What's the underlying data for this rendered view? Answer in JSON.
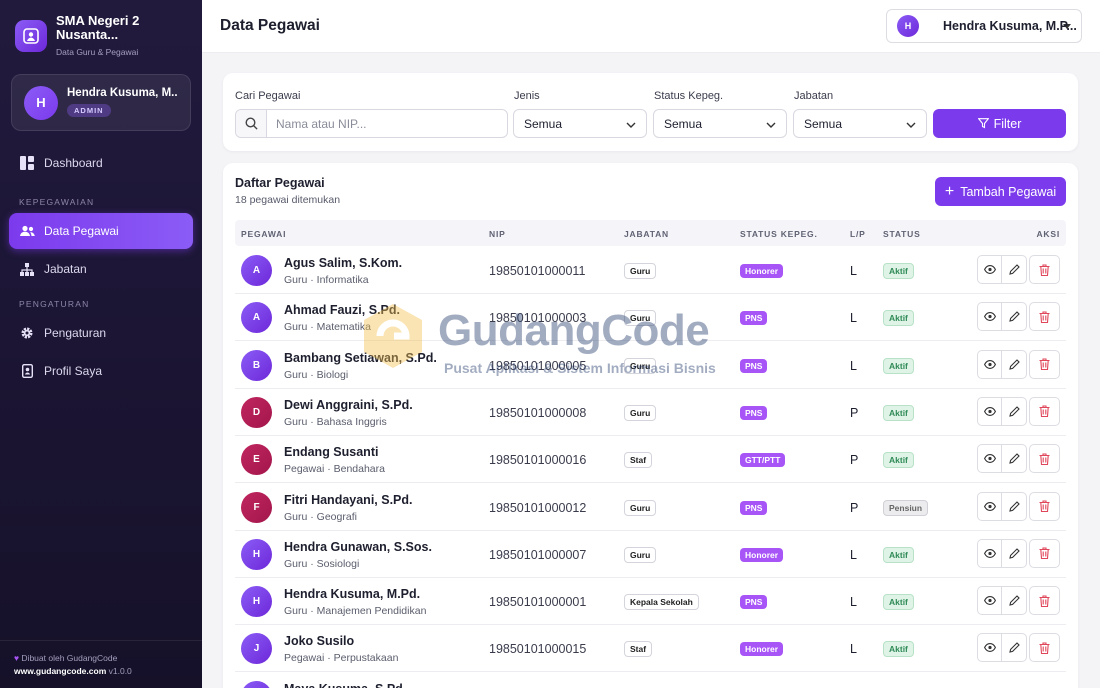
{
  "app": {
    "name": "SMA Negeri 2 Nusanta...",
    "subtitle": "Data Guru & Pegawai"
  },
  "sidebar": {
    "user": {
      "initial": "H",
      "name": "Hendra Kusuma, M...",
      "role": "ADMIN"
    },
    "items": [
      {
        "label": "Dashboard",
        "icon": "dashboard-icon"
      },
      {
        "section": "KEPEGAWAIAN"
      },
      {
        "label": "Data Pegawai",
        "icon": "users-icon",
        "active": true
      },
      {
        "label": "Jabatan",
        "icon": "org-chart-icon"
      },
      {
        "section": "PENGATURAN"
      },
      {
        "label": "Pengaturan",
        "icon": "gear-icon"
      },
      {
        "label": "Profil Saya",
        "icon": "id-badge-icon"
      }
    ],
    "footer": {
      "made_by": "Dibuat oleh GudangCode",
      "site": "www.gudangcode.com",
      "version": "v1.0.0"
    }
  },
  "topbar": {
    "title": "Data Pegawai",
    "user_initial": "H",
    "user_name": "Hendra Kusuma, M.P..."
  },
  "filters": {
    "search_label": "Cari Pegawai",
    "search_placeholder": "Nama atau NIP...",
    "jenis_label": "Jenis",
    "jenis_value": "Semua",
    "status_label": "Status Kepeg.",
    "status_value": "Semua",
    "jabatan_label": "Jabatan",
    "jabatan_value": "Semua",
    "button": "Filter"
  },
  "table": {
    "title": "Daftar Pegawai",
    "count_text": "18 pegawai ditemukan",
    "add_button": "Tambah Pegawai",
    "columns": [
      "PEGAWAI",
      "NIP",
      "JABATAN",
      "STATUS KEPEG.",
      "L/P",
      "STATUS",
      "AKSI"
    ],
    "rows": [
      {
        "initial": "A",
        "name": "Agus Salim, S.Kom.",
        "sub": "Guru · Informatika",
        "nip": "19850101000011",
        "jabatan": "Guru",
        "status_kepeg": "Honorer",
        "lp": "L",
        "status": "Aktif"
      },
      {
        "initial": "A",
        "name": "Ahmad Fauzi, S.Pd.",
        "sub": "Guru · Matematika",
        "nip": "19850101000003",
        "jabatan": "Guru",
        "status_kepeg": "PNS",
        "lp": "L",
        "status": "Aktif"
      },
      {
        "initial": "B",
        "name": "Bambang Setiawan, S.Pd.",
        "sub": "Guru · Biologi",
        "nip": "19850101000005",
        "jabatan": "Guru",
        "status_kepeg": "PNS",
        "lp": "L",
        "status": "Aktif"
      },
      {
        "initial": "D",
        "name": "Dewi Anggraini, S.Pd.",
        "sub": "Guru · Bahasa Inggris",
        "nip": "19850101000008",
        "jabatan": "Guru",
        "status_kepeg": "PNS",
        "lp": "P",
        "status": "Aktif"
      },
      {
        "initial": "E",
        "name": "Endang Susanti",
        "sub": "Pegawai · Bendahara",
        "nip": "19850101000016",
        "jabatan": "Staf",
        "status_kepeg": "GTT/PTT",
        "lp": "P",
        "status": "Aktif"
      },
      {
        "initial": "F",
        "name": "Fitri Handayani, S.Pd.",
        "sub": "Guru · Geografi",
        "nip": "19850101000012",
        "jabatan": "Guru",
        "status_kepeg": "PNS",
        "lp": "P",
        "status": "Pensiun"
      },
      {
        "initial": "H",
        "name": "Hendra Gunawan, S.Sos.",
        "sub": "Guru · Sosiologi",
        "nip": "19850101000007",
        "jabatan": "Guru",
        "status_kepeg": "Honorer",
        "lp": "L",
        "status": "Aktif"
      },
      {
        "initial": "H",
        "name": "Hendra Kusuma, M.Pd.",
        "sub": "Guru · Manajemen Pendidikan",
        "nip": "19850101000001",
        "jabatan": "Kepala Sekolah",
        "status_kepeg": "PNS",
        "lp": "L",
        "status": "Aktif"
      },
      {
        "initial": "J",
        "name": "Joko Susilo",
        "sub": "Pegawai · Perpustakaan",
        "nip": "19850101000015",
        "jabatan": "Staf",
        "status_kepeg": "Honorer",
        "lp": "L",
        "status": "Aktif"
      },
      {
        "initial": "M",
        "name": "Maya Kusuma, S.Pd.",
        "sub": "",
        "nip": "",
        "jabatan": "",
        "status_kepeg": "",
        "lp": "",
        "status": ""
      }
    ]
  },
  "watermark": {
    "title": "GudangCode",
    "subtitle": "Pusat Aplikasi & Sistem Informasi Bisnis"
  },
  "colors": {
    "accent": "#7c3aed",
    "sidebar_bg": "#1b1533",
    "male_avatar": "#7c3aed",
    "female_avatar": "#be185d",
    "status_kepeg": "#a855f7",
    "aktif": "#2f8a56"
  }
}
